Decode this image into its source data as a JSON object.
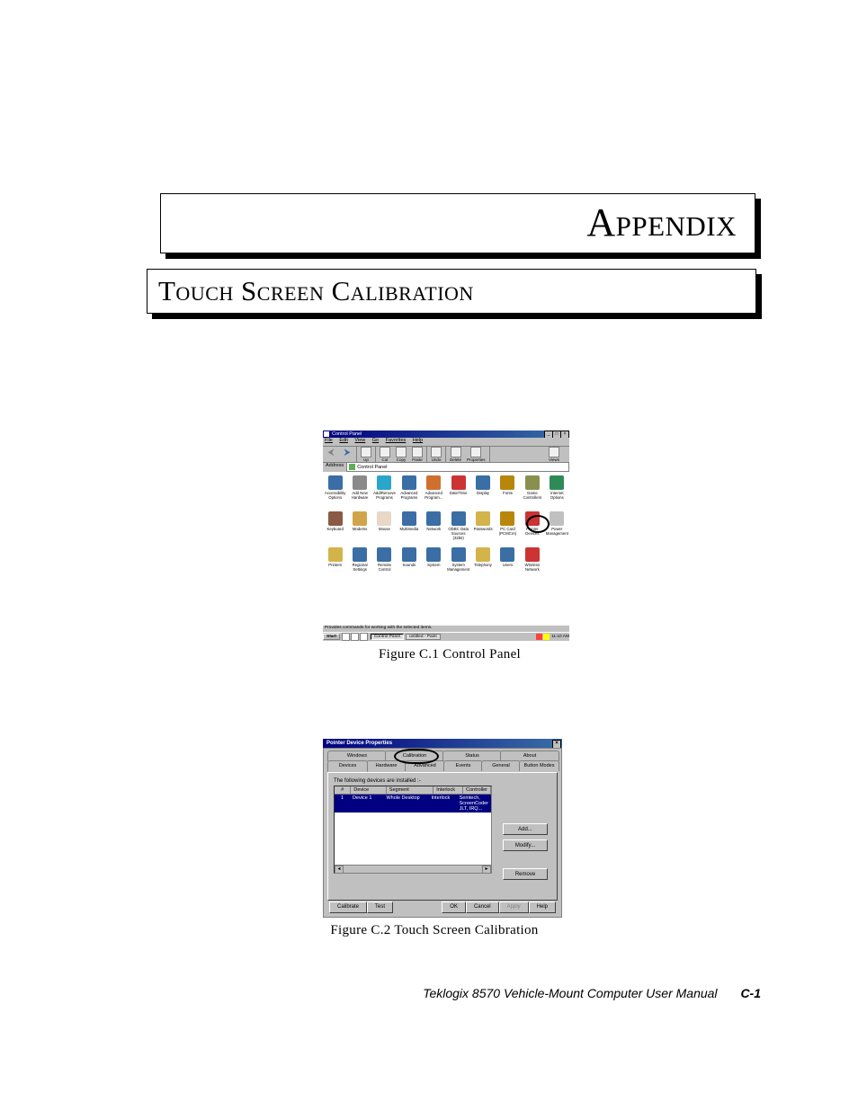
{
  "headings": {
    "appendix": "Appendix",
    "title": "Touch Screen Calibration"
  },
  "captions": {
    "fig1": "Figure C.1   Control Panel",
    "fig2": "Figure C.2   Touch Screen Calibration"
  },
  "footer": {
    "text": "Teklogix 8570 Vehicle-Mount Computer User Manual",
    "page": "C-1"
  },
  "fig1": {
    "title": "Control Panel",
    "menus": [
      "File",
      "Edit",
      "View",
      "Go",
      "Favorites",
      "Help"
    ],
    "toolbar": {
      "back": "Back",
      "forward": "Forward",
      "up": "Up",
      "cut": "Cut",
      "copy": "Copy",
      "paste": "Paste",
      "undo": "Undo",
      "delete": "Delete",
      "properties": "Properties",
      "views": "Views"
    },
    "address": {
      "label": "Address",
      "value": "Control Panel"
    },
    "items": [
      {
        "label": "Accessibility Options",
        "color": "#3a6ea5"
      },
      {
        "label": "Add New Hardware",
        "color": "#8a8a8a"
      },
      {
        "label": "Add/Remove Programs",
        "color": "#29a6c9"
      },
      {
        "label": "Advanced Programs",
        "color": "#3a6ea5"
      },
      {
        "label": "Advanced Program...",
        "color": "#d07030"
      },
      {
        "label": "Date/Time",
        "color": "#c33"
      },
      {
        "label": "Display",
        "color": "#3a6ea5"
      },
      {
        "label": "Fonts",
        "color": "#b8860b"
      },
      {
        "label": "Game Controllers",
        "color": "#8a8f50"
      },
      {
        "label": "Internet Options",
        "color": "#2e8b57"
      },
      {
        "label": "Keyboard",
        "color": "#8a5a44"
      },
      {
        "label": "Modems",
        "color": "#d2a44a"
      },
      {
        "label": "Mouse",
        "color": "#e8d8c8"
      },
      {
        "label": "Multimedia",
        "color": "#3a6ea5"
      },
      {
        "label": "Network",
        "color": "#3a6ea5"
      },
      {
        "label": "ODBC Data Sources (32bit)",
        "color": "#3a6ea5"
      },
      {
        "label": "Passwords",
        "color": "#d2b44a"
      },
      {
        "label": "PC Card (PCMCIA)",
        "color": "#b8860b"
      },
      {
        "label": "Pointer Devices",
        "color": "#c33"
      },
      {
        "label": "Power Management",
        "color": "#c0c0c0"
      },
      {
        "label": "Printers",
        "color": "#d2b44a"
      },
      {
        "label": "Regional Settings",
        "color": "#3a6ea5"
      },
      {
        "label": "Remote Control",
        "color": "#3a6ea5"
      },
      {
        "label": "Sounds",
        "color": "#3a6ea5"
      },
      {
        "label": "System",
        "color": "#3a6ea5"
      },
      {
        "label": "System Management",
        "color": "#3a6ea5"
      },
      {
        "label": "Telephony",
        "color": "#d2b44a"
      },
      {
        "label": "Users",
        "color": "#3a6ea5"
      },
      {
        "label": "Wireless Network",
        "color": "#c33"
      }
    ],
    "status": "Provides commands for working with the selected items.",
    "taskbar": {
      "start": "Start",
      "tasks": [
        "Control Panel",
        "untitled - Paint"
      ],
      "clock": "11:10 AM"
    }
  },
  "fig2": {
    "title": "Pointer Device Properties",
    "tabs_row1": [
      "Windows",
      "Calibration",
      "Status",
      "About"
    ],
    "tabs_row2": [
      "Devices",
      "Hardware",
      "Advanced",
      "Events",
      "General",
      "Button Modes"
    ],
    "active_tab": "Devices",
    "panel_text": "The following devices are installed :-",
    "columns": [
      "#",
      "Device",
      "Segment",
      "Interlock",
      "Controller"
    ],
    "rows": [
      {
        "n": "1",
        "device": "Device 1",
        "segment": "Whole Desktop",
        "interlock": "Interlock",
        "controller": "Semtech, ScreenCoder JLT, IRQ..."
      }
    ],
    "side_buttons": {
      "add": "Add...",
      "modify": "Modify...",
      "remove": "Remove"
    },
    "bottom_buttons": {
      "calibrate": "Calibrate",
      "test": "Test",
      "ok": "OK",
      "cancel": "Cancel",
      "apply": "Apply",
      "help": "Help"
    }
  }
}
